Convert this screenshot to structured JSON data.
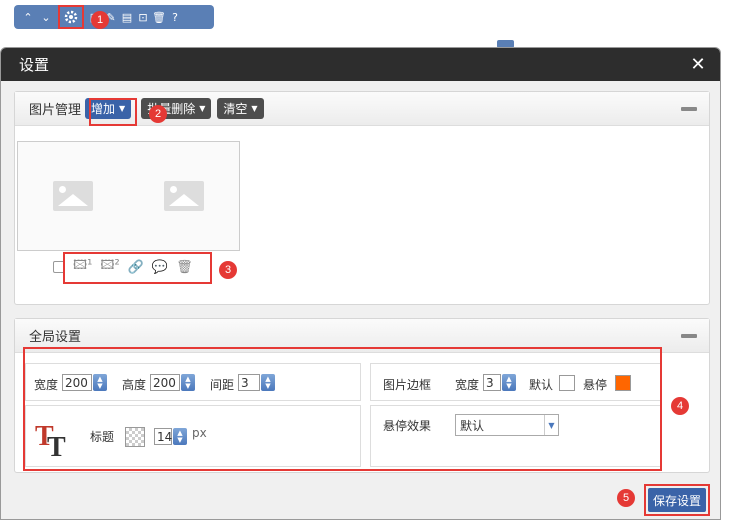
{
  "toolbar": {
    "icons": [
      "chevron-up-icon",
      "chevron-down-icon",
      "gear-icon",
      "image-icon",
      "brush-icon",
      "chart-icon",
      "unlock-icon",
      "trash-icon",
      "help-icon"
    ]
  },
  "badges": [
    "1",
    "2",
    "3",
    "4",
    "5"
  ],
  "dialog": {
    "title": "设置",
    "close_glyph": "✕"
  },
  "image_panel": {
    "title": "图片管理",
    "add_label": "增加",
    "batch_delete_label": "批量删除",
    "clear_label": "清空"
  },
  "global_panel": {
    "title": "全局设置",
    "width_label": "宽度",
    "width_value": "200",
    "height_label": "高度",
    "height_value": "200",
    "spacing_label": "间距",
    "spacing_value": "3",
    "border_label": "图片边框",
    "border_width_label": "宽度",
    "border_width_value": "3",
    "default_label": "默认",
    "hover_label": "悬停",
    "hover_color": "#ff6600",
    "title_label": "标题",
    "title_size_value": "14",
    "title_size_unit": "px",
    "hover_effect_label": "悬停效果",
    "hover_effect_value": "默认"
  },
  "save_label": "保存设置",
  "colors": {
    "accent": "#3a63a8",
    "annotation": "#e53935"
  }
}
